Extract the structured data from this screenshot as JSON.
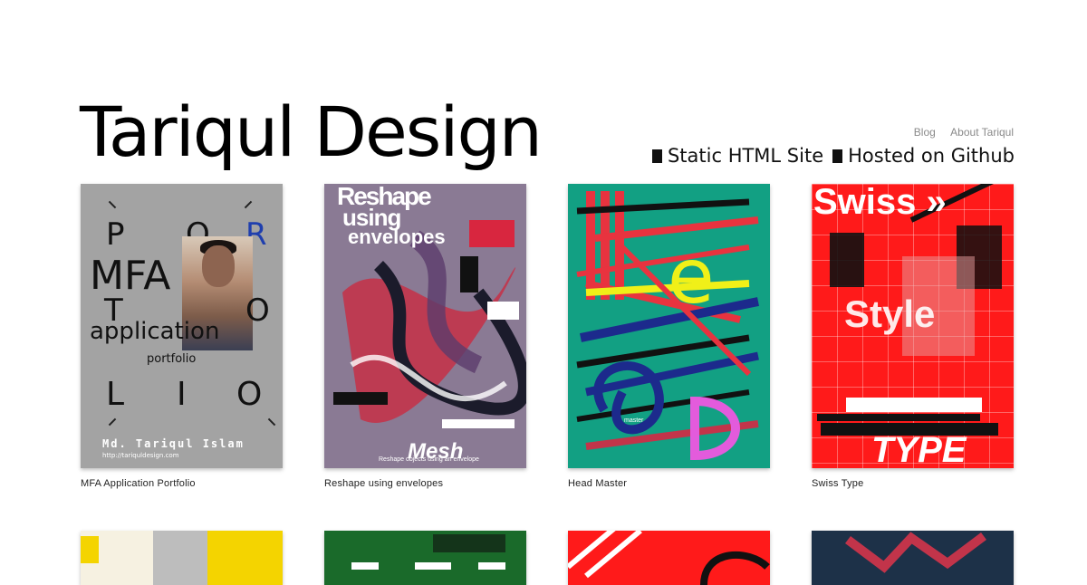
{
  "site": {
    "title": "Tariqul Design",
    "nav": [
      "Blog",
      "About Tariqul"
    ],
    "tagline": [
      "Static HTML Site",
      "Hosted on Github"
    ]
  },
  "posters": [
    {
      "caption": "MFA Application Portfolio",
      "art": {
        "top_left": "P",
        "top_mid": "O",
        "top_right": "R",
        "line2": "MFA",
        "line3_left": "T",
        "line3_right": "O",
        "line4": "application",
        "line5": "portfolio",
        "bottom_letters": [
          "L",
          "I",
          "O"
        ],
        "name": "Md. Tariqul Islam",
        "url": "http://tariquldesign.com"
      }
    },
    {
      "caption": "Reshape using envelopes",
      "art": {
        "headline": [
          "Reshape",
          "using",
          "envelopes"
        ],
        "footer": "Mesh",
        "subfooter": "Reshape objects using an envelope"
      }
    },
    {
      "caption": "Head Master",
      "art": {
        "letters": [
          "e",
          "D"
        ],
        "label": "master"
      }
    },
    {
      "caption": "Swiss Type",
      "art": {
        "headline": "Swiss »",
        "middle": "Style",
        "footer": "TYPE"
      }
    }
  ],
  "colors": {
    "poster3_bg": "#12a083",
    "poster4_bg": "#ff1a1a",
    "poster2_bg": "#8a7a94",
    "poster1_bg": "#a3a3a3"
  }
}
